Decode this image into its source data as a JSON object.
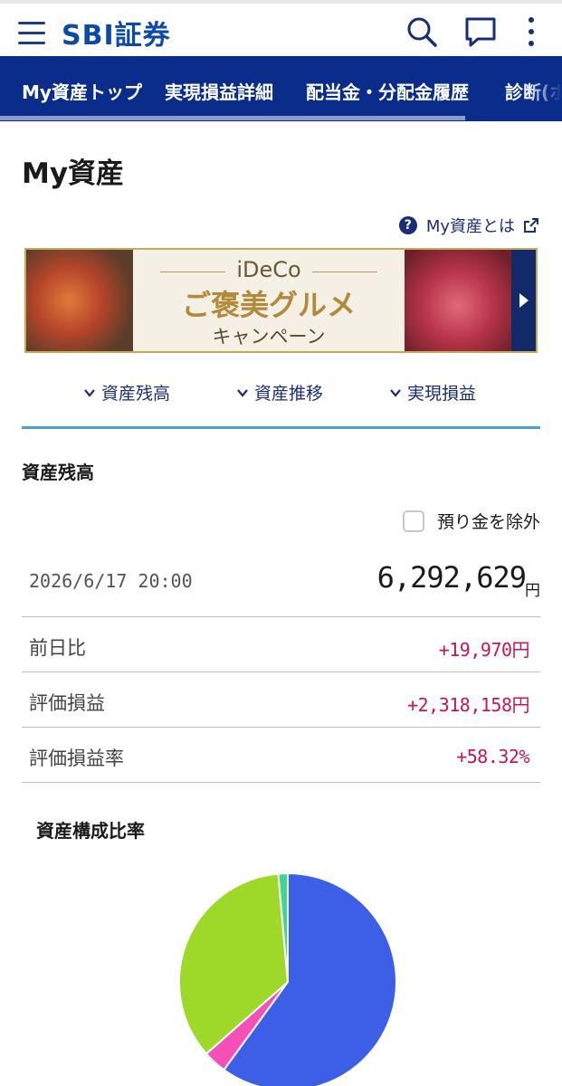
{
  "header": {
    "logo": "SBI証券",
    "menu_icon": "hamburger-icon",
    "search_icon": "search-icon",
    "chat_icon": "chat-icon",
    "more_icon": "more-vertical-icon"
  },
  "tabs": [
    {
      "label": "My資産トップ"
    },
    {
      "label": "実現損益詳細"
    },
    {
      "label": "配当金・分配金履歴"
    },
    {
      "label": "診断(ホ"
    }
  ],
  "page": {
    "title": "My資産",
    "about_label": "My資産とは"
  },
  "banner": {
    "line1": "iDeCo",
    "line2": "ご褒美グルメ",
    "line3": "キャンペーン"
  },
  "anchors": [
    {
      "label": "資産残高"
    },
    {
      "label": "資産推移"
    },
    {
      "label": "実現損益"
    }
  ],
  "balance": {
    "section_title": "資産残高",
    "exclude_label": "預り金を除外",
    "date": "2026/6/17 20:00",
    "total": "6,292,629",
    "yen": "円",
    "rows": [
      {
        "label": "前日比",
        "value": "+19,970円"
      },
      {
        "label": "評価損益",
        "value": "+2,318,158円"
      },
      {
        "label": "評価損益率",
        "value": "+58.32%"
      }
    ]
  },
  "composition": {
    "title": "資産構成比率"
  },
  "chart_data": {
    "type": "pie",
    "title": "資産構成比率",
    "slices": [
      {
        "value": 60.0,
        "color": "#3d5ee6"
      },
      {
        "value": 3.5,
        "color": "#f54fb8"
      },
      {
        "value": 35.1,
        "color": "#9ed92a"
      },
      {
        "value": 1.4,
        "color": "#3ed78e"
      }
    ]
  },
  "colors": {
    "brand_blue": "#0b4aa7",
    "tab_bg": "#0a2d8c",
    "positive": "#c2185b",
    "accent_line": "#4aa0d6"
  }
}
